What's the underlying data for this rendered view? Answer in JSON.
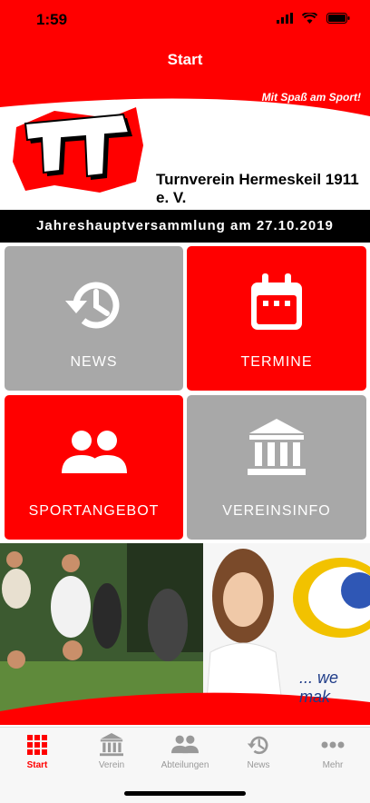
{
  "status": {
    "time": "1:59"
  },
  "navbar": {
    "title": "Start"
  },
  "banner": {
    "slogan": "Mit Spaß am Sport!",
    "logo_text": "TVH",
    "club_name": "Turnverein Hermeskeil 1911 e. V."
  },
  "ticker": {
    "text": "Jahreshauptversammlung am 27.10.2019"
  },
  "tiles": [
    {
      "label": "NEWS",
      "icon": "history-icon"
    },
    {
      "label": "TERMINE",
      "icon": "calendar-icon"
    },
    {
      "label": "SPORTANGEBOT",
      "icon": "people-icon"
    },
    {
      "label": "VEREINSINFO",
      "icon": "institution-icon"
    }
  ],
  "promo": {
    "caption": "... we mak"
  },
  "tabbar": [
    {
      "label": "Start",
      "icon": "grid-icon",
      "active": true
    },
    {
      "label": "Verein",
      "icon": "institution-icon",
      "active": false
    },
    {
      "label": "Abteilungen",
      "icon": "people-icon",
      "active": false
    },
    {
      "label": "News",
      "icon": "history-icon",
      "active": false
    },
    {
      "label": "Mehr",
      "icon": "more-icon",
      "active": false
    }
  ],
  "colors": {
    "brand_red": "#ff0000",
    "tile_gray": "#a8a8a8",
    "ticker_bg": "#000000"
  }
}
